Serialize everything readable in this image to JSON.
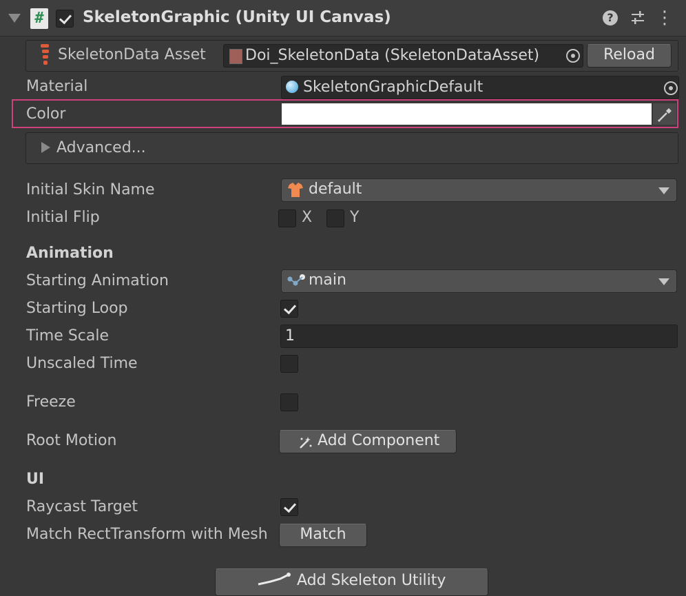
{
  "component": {
    "title": "SkeletonGraphic (Unity UI Canvas)",
    "enabled": true,
    "script_glyph": "#",
    "help_glyph": "?",
    "settings_glyph": "⚟",
    "more_glyph": "⋮"
  },
  "skeleton_data": {
    "label": "SkeletonData Asset",
    "value": "Doi_SkeletonData (SkeletonDataAsset)",
    "reload_label": "Reload"
  },
  "material": {
    "label": "Material",
    "value": "SkeletonGraphicDefault"
  },
  "color": {
    "label": "Color",
    "value": "#ffffff"
  },
  "advanced": {
    "label": "Advanced..."
  },
  "initial_skin": {
    "label": "Initial Skin Name",
    "value": "default"
  },
  "initial_flip": {
    "label": "Initial Flip",
    "x_label": "X",
    "y_label": "Y",
    "x": false,
    "y": false
  },
  "animation": {
    "header": "Animation",
    "starting_label": "Starting Animation",
    "starting_value": "main",
    "loop_label": "Starting Loop",
    "loop": true,
    "timescale_label": "Time Scale",
    "timescale_value": "1",
    "unscaled_label": "Unscaled Time",
    "unscaled": false,
    "freeze_label": "Freeze",
    "freeze": false,
    "root_motion_label": "Root Motion",
    "add_component_label": "Add Component"
  },
  "ui": {
    "header": "UI",
    "raycast_label": "Raycast Target",
    "raycast": true,
    "match_label": "Match RectTransform with Mesh",
    "match_button": "Match"
  },
  "utility_button": "Add Skeleton Utility",
  "colors": {
    "highlight": "#d0407a",
    "background": "#383838"
  }
}
